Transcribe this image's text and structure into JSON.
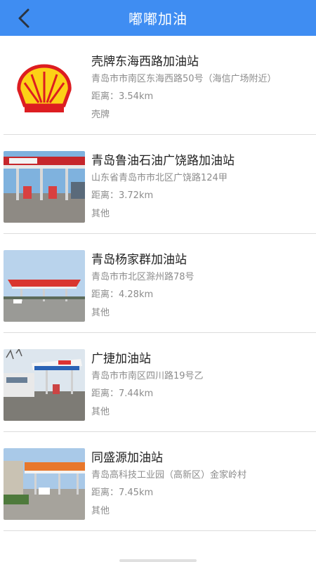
{
  "header": {
    "title": "嘟嘟加油",
    "background": "#3f8df2"
  },
  "stations": [
    {
      "name": "壳牌东海西路加油站",
      "address": "青岛市市南区东海西路50号（海信广场附近）",
      "distance": "距离：3.54km",
      "brand": "壳牌",
      "thumb": "shell-logo"
    },
    {
      "name": "青岛鲁油石油广饶路加油站",
      "address": "山东省青岛市市北区广饶路124甲",
      "distance": "距离：3.72km",
      "brand": "其他",
      "thumb": "station-photo-red-canopy"
    },
    {
      "name": "青岛杨家群加油站",
      "address": "青岛市市北区滁州路78号",
      "distance": "距离：4.28km",
      "brand": "其他",
      "thumb": "station-photo-flat-canopy"
    },
    {
      "name": "广捷加油站",
      "address": "青岛市市南区四川路19号乙",
      "distance": "距离：7.44km",
      "brand": "其他",
      "thumb": "station-photo-trees"
    },
    {
      "name": "同盛源加油站",
      "address": "青岛高科技工业园（高新区）金家岭村",
      "distance": "距离：7.45km",
      "brand": "其他",
      "thumb": "station-photo-orange-canopy"
    }
  ]
}
